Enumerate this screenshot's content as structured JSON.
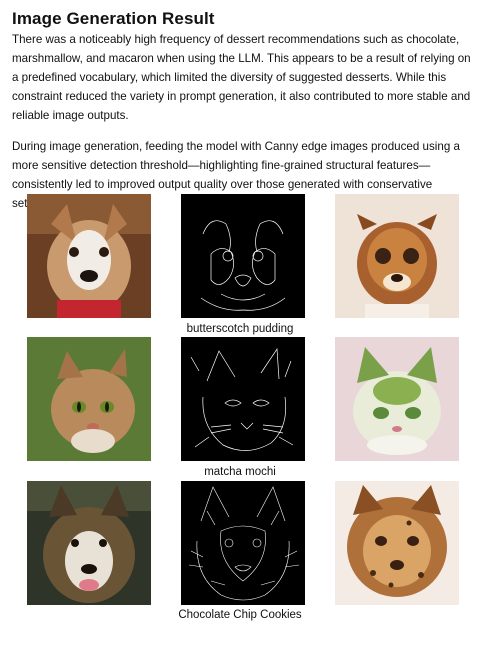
{
  "title": "Image Generation Result",
  "paragraphs": [
    "There was a noticeably high frequency of dessert recommendations such as chocolate, marshmallow, and macaron when using the LLM. This appears to be a result of relying on a predefined vocabulary, which limited the diversity of suggested desserts. While this constraint reduced the variety in prompt generation, it also contributed to more stable and reliable image outputs.",
    "During image generation, feeding the model with Canny edge images produced using a more sensitive detection threshold—highlighting fine-grained structural features—consistently led to improved output quality over those generated with conservative settings."
  ],
  "rows": [
    {
      "caption": "butterscotch pudding",
      "original": "dog-photo",
      "edges": "dog-canny-edges",
      "generated": "butterscotch-pudding-dog"
    },
    {
      "caption": "matcha mochi",
      "original": "cat-photo",
      "edges": "cat-canny-edges",
      "generated": "matcha-mochi-cat"
    },
    {
      "caption": "Chocolate Chip Cookies",
      "original": "dog-photo-2",
      "edges": "dog-2-canny-edges",
      "generated": "chocolate-chip-cookies-dog"
    }
  ]
}
